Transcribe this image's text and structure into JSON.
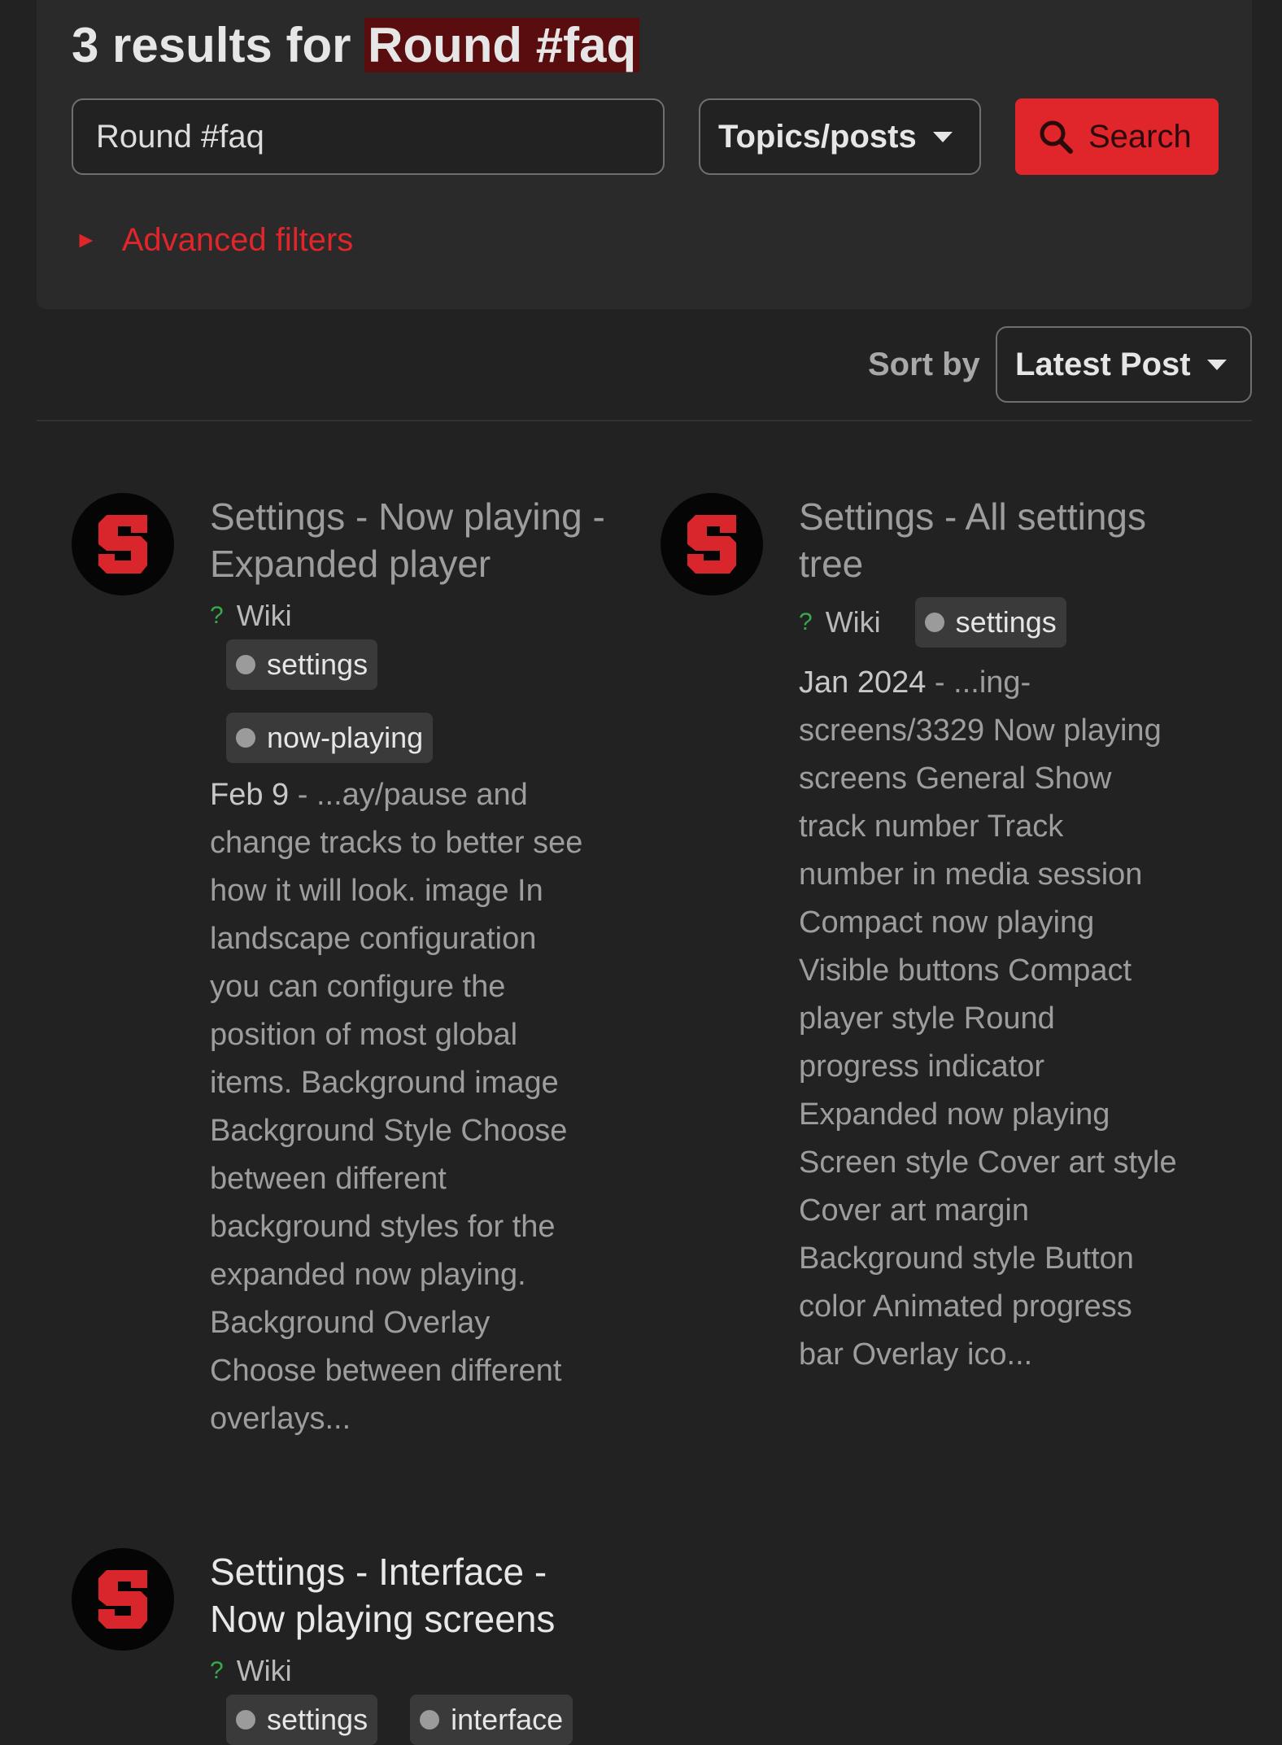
{
  "header": {
    "results_prefix": "3 results for",
    "query": "Round #faq"
  },
  "search": {
    "value": "Round #faq",
    "type_label": "Topics/posts",
    "button_label": "Search",
    "advanced_label": "Advanced filters"
  },
  "sort": {
    "label": "Sort by",
    "value": "Latest Post"
  },
  "colors": {
    "accent": "#e0252b",
    "background": "#222222",
    "wiki": "#38a84a"
  },
  "results": [
    {
      "title_line1": "Settings - Now playing -",
      "title_line2": "Expanded player",
      "wiki": "Wiki",
      "tags": [
        "settings",
        "now-playing"
      ],
      "date": "Feb 9",
      "lines": [
        "...ay/pause and",
        "change tracks to better see",
        "how it will look. image In",
        "landscape configuration",
        "you can configure the",
        "position of most global",
        "items. Background image",
        "Background Style Choose",
        "between different",
        "background styles for the",
        "expanded now playing.",
        "Background Overlay",
        "Choose between different",
        "overlays..."
      ]
    },
    {
      "title_line1": "Settings - All settings",
      "title_line2": "tree",
      "wiki": "Wiki",
      "tags": [
        "settings"
      ],
      "date": "Jan 2024",
      "lines": [
        "...ing-",
        "screens/3329 Now playing",
        "screens General Show",
        "track number Track",
        "number in media session",
        "Compact now playing",
        "Visible buttons Compact",
        "player style Round",
        "progress indicator",
        "Expanded now playing",
        "Screen style Cover art style",
        "Cover art margin",
        "Background style Button",
        "color Animated progress",
        "bar Overlay ico..."
      ]
    },
    {
      "title_line1": "Settings - Interface -",
      "title_line2": "Now playing screens",
      "wiki": "Wiki",
      "tags": [
        "settings",
        "interface"
      ]
    }
  ]
}
